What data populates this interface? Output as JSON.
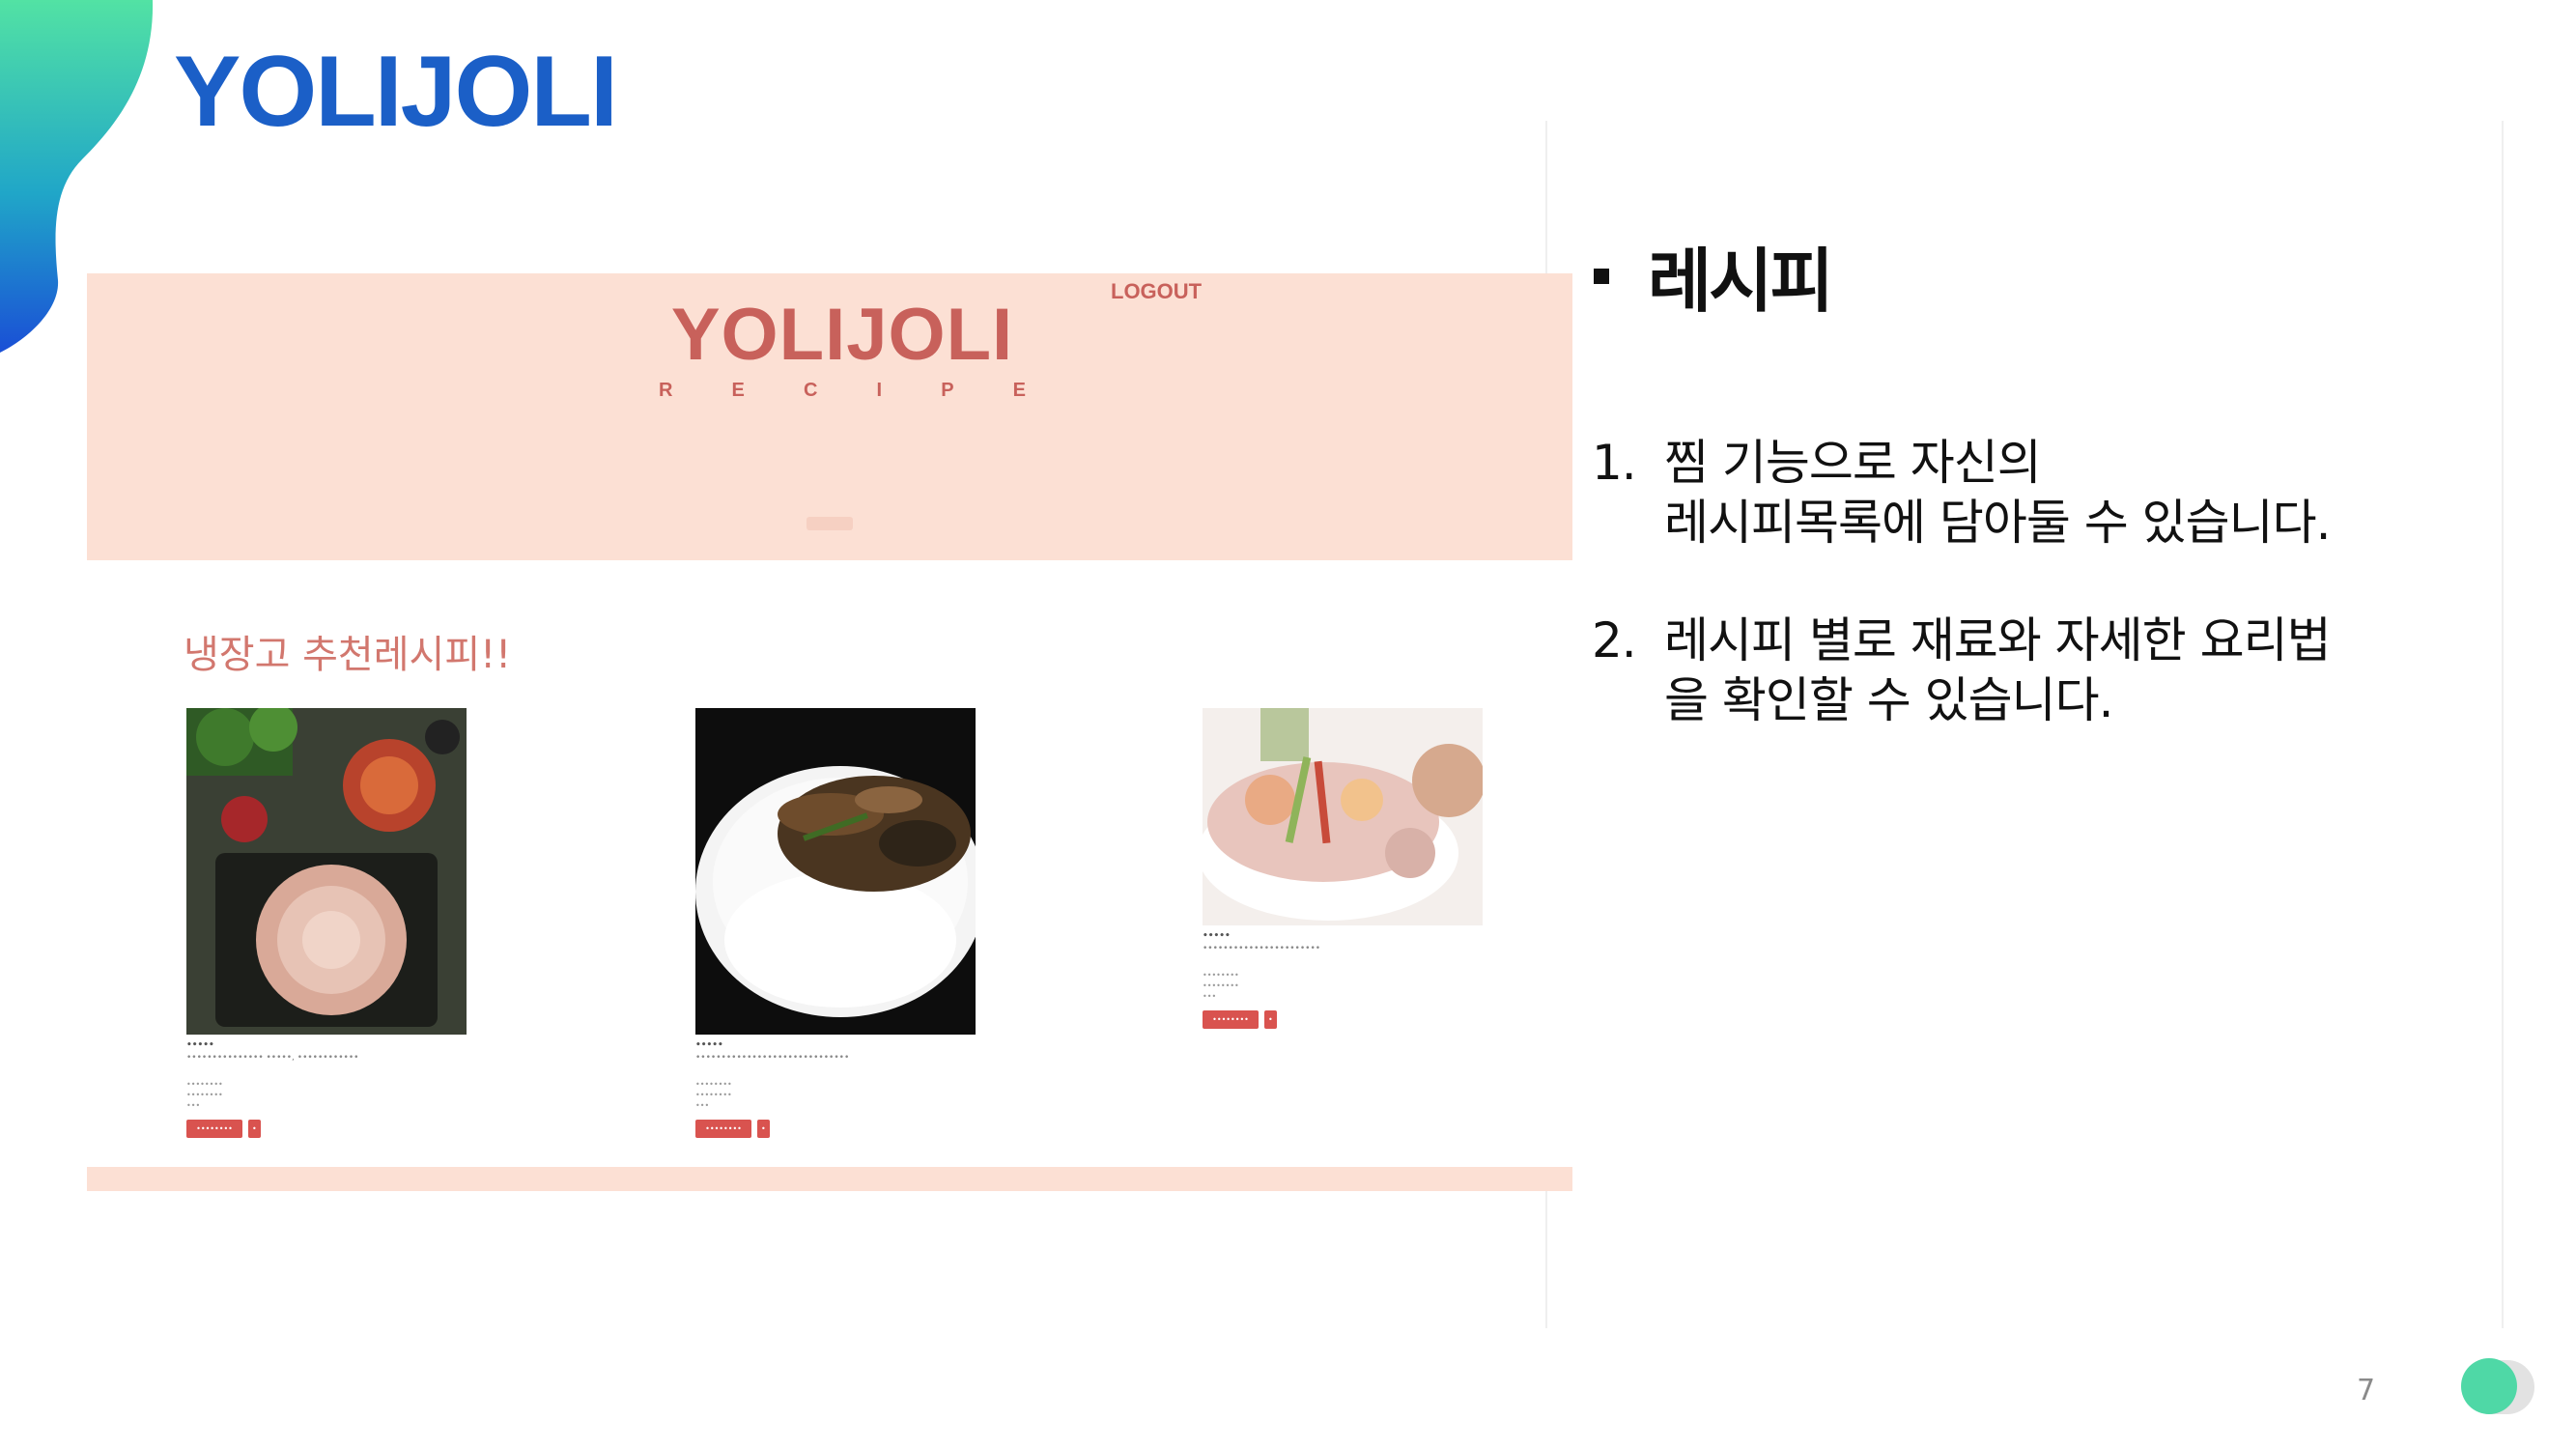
{
  "slide": {
    "title": "YOLIJOLI",
    "page_number": "7"
  },
  "site": {
    "logo": "YOLIJOLI",
    "logo_sub_letters": [
      "R",
      "E",
      "C",
      "I",
      "P",
      "E"
    ],
    "logout_label": "LOGOUT",
    "section_heading": "냉장고 추천레시피!!",
    "cards": [
      {
        "name": "•••••",
        "desc": "••••••••••••••• •••••, ••••••••••••",
        "meta": [
          "••••••••",
          "••••••••",
          "•••"
        ],
        "button": "••••••••",
        "small_button": "•"
      },
      {
        "name": "•••••",
        "desc": "••••••••••••••••••••••••••••••",
        "meta": [
          "••••••••",
          "••••••••",
          "•••"
        ],
        "button": "••••••••",
        "small_button": "•"
      },
      {
        "name": "•••••",
        "desc": "•••••••••••••••••••••••",
        "meta": [
          "••••••••",
          "••••••••",
          "•••"
        ],
        "button": "••••••••",
        "small_button": "•"
      }
    ]
  },
  "panel": {
    "heading": "레시피",
    "points": [
      {
        "num": "1.",
        "text": " 찜 기능으로 자신의\n레시피목록에 담아둘 수 있습니다."
      },
      {
        "num": "2.",
        "text": "레시피 별로 재료와 자세한  요리법\n을  확인할 수 있습니다."
      }
    ]
  },
  "colors": {
    "title_blue": "#1b5fc7",
    "site_pink": "#fce0d4",
    "site_accent": "#c8615b",
    "button_red": "#d9534f",
    "toggle_green": "#4fd8a6"
  }
}
